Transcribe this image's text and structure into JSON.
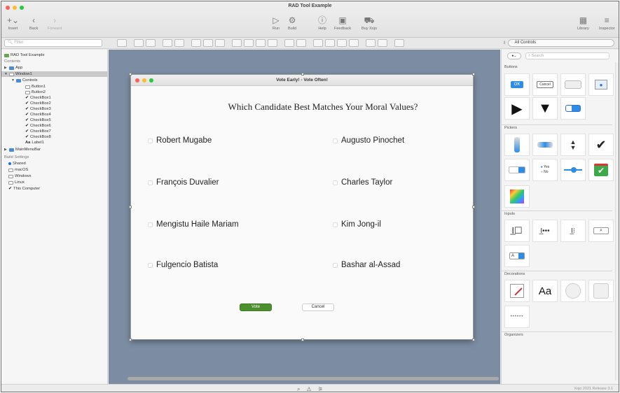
{
  "app": {
    "window_title": "RAD Tool Example"
  },
  "toolbar_left": [
    {
      "icon": "plus-icon",
      "label": "Insert"
    },
    {
      "icon": "back-icon",
      "label": "Back"
    },
    {
      "icon": "forward-icon",
      "label": "Forward"
    }
  ],
  "toolbar_center": [
    {
      "icon": "run-icon",
      "label": "Run"
    },
    {
      "icon": "build-icon",
      "label": "Build"
    },
    {
      "icon": "help-icon",
      "label": "Help"
    },
    {
      "icon": "feedback-icon",
      "label": "Feedback"
    },
    {
      "icon": "cart-icon",
      "label": "Buy Xojo"
    }
  ],
  "toolbar_right": [
    {
      "icon": "library-icon",
      "label": "Library"
    },
    {
      "icon": "inspector-icon",
      "label": "Inspector"
    }
  ],
  "filter": {
    "placeholder": "Filter"
  },
  "library_filter": {
    "value": "All Controls"
  },
  "navigator": {
    "project": "RAD Tool Example",
    "contents_label": "Contents",
    "app": "App",
    "window": "Window1",
    "controls": "Controls",
    "items": [
      "Button1",
      "Button2",
      "CheckBox1",
      "CheckBox2",
      "CheckBox3",
      "CheckBox4",
      "CheckBox5",
      "CheckBox6",
      "CheckBox7",
      "CheckBox8",
      "Label1"
    ],
    "menubar": "MainMenuBar",
    "build_settings_label": "Build Settings",
    "build_items": [
      "Shared",
      "macOS",
      "Windows",
      "Linux",
      "This Computer"
    ]
  },
  "dialog": {
    "title": "Vote Early! - Vote Often!",
    "question": "Which Candidate Best Matches Your Moral Values?",
    "candidates_left": [
      "Robert Mugabe",
      "François Duvalier",
      "Mengistu Haile Mariam",
      "Fulgencio Batista"
    ],
    "candidates_right": [
      "Augusto Pinochet",
      "Charles Taylor",
      "Kim Jong-il",
      "Bashar al-Assad"
    ],
    "vote_label": "Vote",
    "cancel_label": "Cancel"
  },
  "library": {
    "search_placeholder": "Search",
    "sections": [
      "Buttons",
      "Pickers",
      "Inputs",
      "Decorations",
      "Organizers"
    ],
    "ok_label": "OK",
    "cancel_label": "Cancel",
    "radio_yes": "Yes",
    "radio_no": "No",
    "label_sample": "Aa"
  },
  "status": {
    "release": "Xojo 2021 Release 3.1"
  }
}
